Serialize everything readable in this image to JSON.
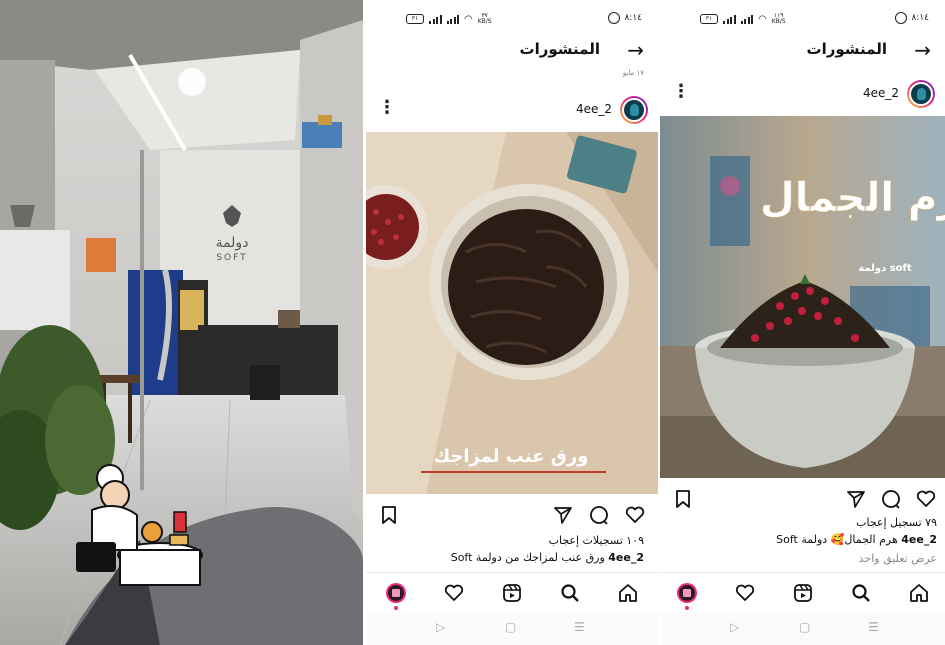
{
  "photo": {
    "sign_text": "دولمة",
    "sign_sub": "SOFT"
  },
  "phone_left": {
    "status": {
      "time": "٨:١٤",
      "speed_top": "٣٧",
      "speed_bottom": "KB/S",
      "battery": "٣١"
    },
    "header": {
      "title": "المنشورات",
      "date_hint": "١٧ مايو"
    },
    "post": {
      "username": "4ee_2",
      "image_text": "ورق عنب لمزاجك",
      "likes": "١٠٩ تسجيلات إعجاب",
      "caption_user": "4ee_2",
      "caption_text": "ورق عنب لمزاجك من دولمة Soft"
    },
    "nav": [
      "home-icon",
      "search-icon",
      "reels-icon",
      "heart-icon",
      "profile-icon"
    ],
    "system_nav": {
      "back": "▷",
      "home": "▢",
      "menu": "☰"
    }
  },
  "phone_right": {
    "status": {
      "time": "٨:١٤",
      "speed_top": "١١٩",
      "speed_bottom": "KB/S",
      "battery": "٣١"
    },
    "header": {
      "title": "المنشورات"
    },
    "post": {
      "username": "4ee_2",
      "image_title": "هرم الجمال",
      "image_sub": "دولمة soft",
      "likes": "٧٩ تسجيل إعجاب",
      "caption_user": "4ee_2",
      "caption_text": "هرم الجمال🥰 دولمة Soft",
      "comments_link": "عرض تعليق واحد"
    },
    "nav": [
      "home-icon",
      "search-icon",
      "reels-icon",
      "heart-icon",
      "profile-icon"
    ],
    "system_nav": {
      "back": "▷",
      "home": "▢",
      "menu": "☰"
    }
  },
  "colors": {
    "accent": "#e1306c",
    "story_ring": "#ee2a7b",
    "text": "#111111",
    "muted": "#888888"
  }
}
